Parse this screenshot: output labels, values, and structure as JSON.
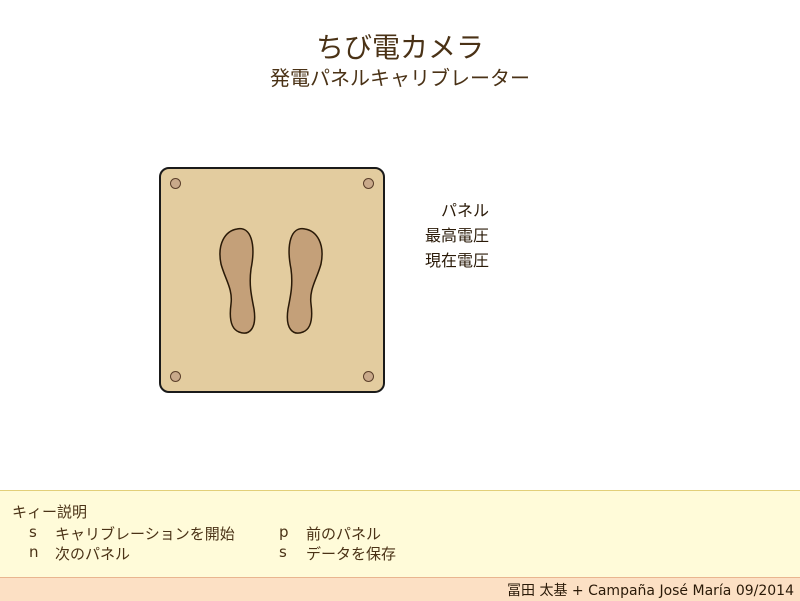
{
  "header": {
    "title": "ちび電カメラ",
    "subtitle": "発電パネルキャリブレーター"
  },
  "panel_info": {
    "panel_label": "パネル",
    "max_voltage_label": "最高電圧",
    "current_voltage_label": "現在電圧"
  },
  "help": {
    "title": "キィー説明",
    "keys": [
      {
        "key": "s",
        "desc": "キャリブレーションを開始"
      },
      {
        "key": "n",
        "desc": "次のパネル"
      },
      {
        "key": "p",
        "desc": "前のパネル"
      },
      {
        "key": "s",
        "desc": "データを保存"
      }
    ]
  },
  "footer": {
    "credit": "冨田 太基 + Campaña José María 09/2014"
  },
  "colors": {
    "panel": "#e3cc9f",
    "footprint": "#c4a079",
    "help_background": "#fffbd9",
    "footer_background": "#fce0c4"
  }
}
